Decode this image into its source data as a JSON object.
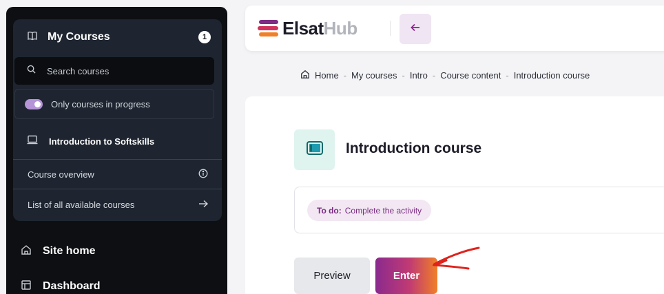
{
  "sidebar": {
    "header_title": "My Courses",
    "course_count": "1",
    "search_placeholder": "Search courses",
    "filter_label": "Only courses in progress",
    "filter_enabled": true,
    "current_course": "Introduction to Softskills",
    "links": [
      {
        "label": "Course overview",
        "icon": "info-icon"
      },
      {
        "label": "List of all available courses",
        "icon": "arrow-right-icon"
      }
    ],
    "nav": [
      {
        "label": "Site home",
        "icon": "home-icon"
      },
      {
        "label": "Dashboard",
        "icon": "dashboard-icon"
      }
    ]
  },
  "topbar": {
    "logo_part1": "Elsat",
    "logo_part2": "Hub",
    "back_icon": "arrow-left-icon"
  },
  "breadcrumb": [
    "Home",
    "My courses",
    "Intro",
    "Course content",
    "Introduction course"
  ],
  "main": {
    "course_title": "Introduction course",
    "course_icon": "course-screen-icon",
    "todo_label": "To do:",
    "todo_text": "Complete the activity",
    "preview_label": "Preview",
    "enter_label": "Enter"
  },
  "colors": {
    "sidebar_bg": "#0d0f12",
    "panel_bg": "#1e2530",
    "toggle_on": "#b594d8",
    "accent_purple": "#8a2a8e",
    "accent_orange": "#f07f28",
    "badge_bg": "#f2e7f3",
    "annotation_red": "#e0221c"
  }
}
